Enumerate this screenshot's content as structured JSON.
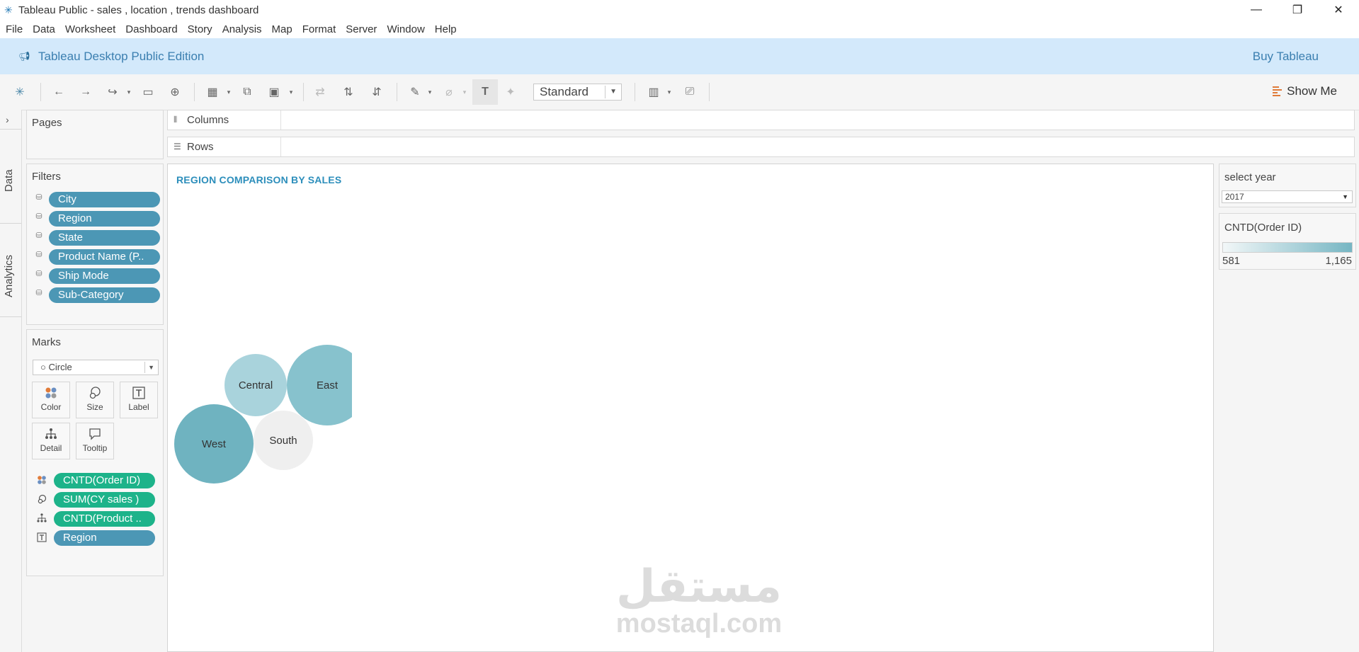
{
  "window": {
    "title": "Tableau Public - sales , location , trends dashboard"
  },
  "menu": [
    "File",
    "Data",
    "Worksheet",
    "Dashboard",
    "Story",
    "Analysis",
    "Map",
    "Format",
    "Server",
    "Window",
    "Help"
  ],
  "banner": {
    "edition": "Tableau Desktop Public Edition",
    "buy": "Buy Tableau"
  },
  "toolbar": {
    "fit_mode": "Standard",
    "show_me": "Show Me"
  },
  "side_tabs": {
    "data": "Data",
    "analytics": "Analytics"
  },
  "pages": {
    "title": "Pages"
  },
  "filters": {
    "title": "Filters",
    "items": [
      "City",
      "Region",
      "State",
      "Product Name (P..",
      "Ship Mode",
      "Sub-Category"
    ]
  },
  "marks": {
    "title": "Marks",
    "type": "Circle",
    "buttons": [
      "Color",
      "Size",
      "Label",
      "Detail",
      "Tooltip"
    ],
    "fields": [
      "CNTD(Order ID)",
      "SUM(CY sales )",
      "CNTD(Product ..",
      "Region"
    ]
  },
  "shelves": {
    "columns": "Columns",
    "rows": "Rows"
  },
  "view": {
    "title": "REGION COMPARISON BY SALES",
    "bubbles": [
      {
        "label": "Central",
        "color": "#a9d3dc"
      },
      {
        "label": "East",
        "color": "#87c2cd"
      },
      {
        "label": "West",
        "color": "#6fb3c0"
      },
      {
        "label": "South",
        "color": "#efefef"
      }
    ]
  },
  "parameter": {
    "title": "select year",
    "value": "2017"
  },
  "legend": {
    "title": "CNTD(Order ID)",
    "min": "581",
    "max": "1,165",
    "color_low": "#f2f7f8",
    "color_high": "#76b6c3"
  },
  "watermark": {
    "arabic": "مستقل",
    "latin": "mostaql.com"
  }
}
